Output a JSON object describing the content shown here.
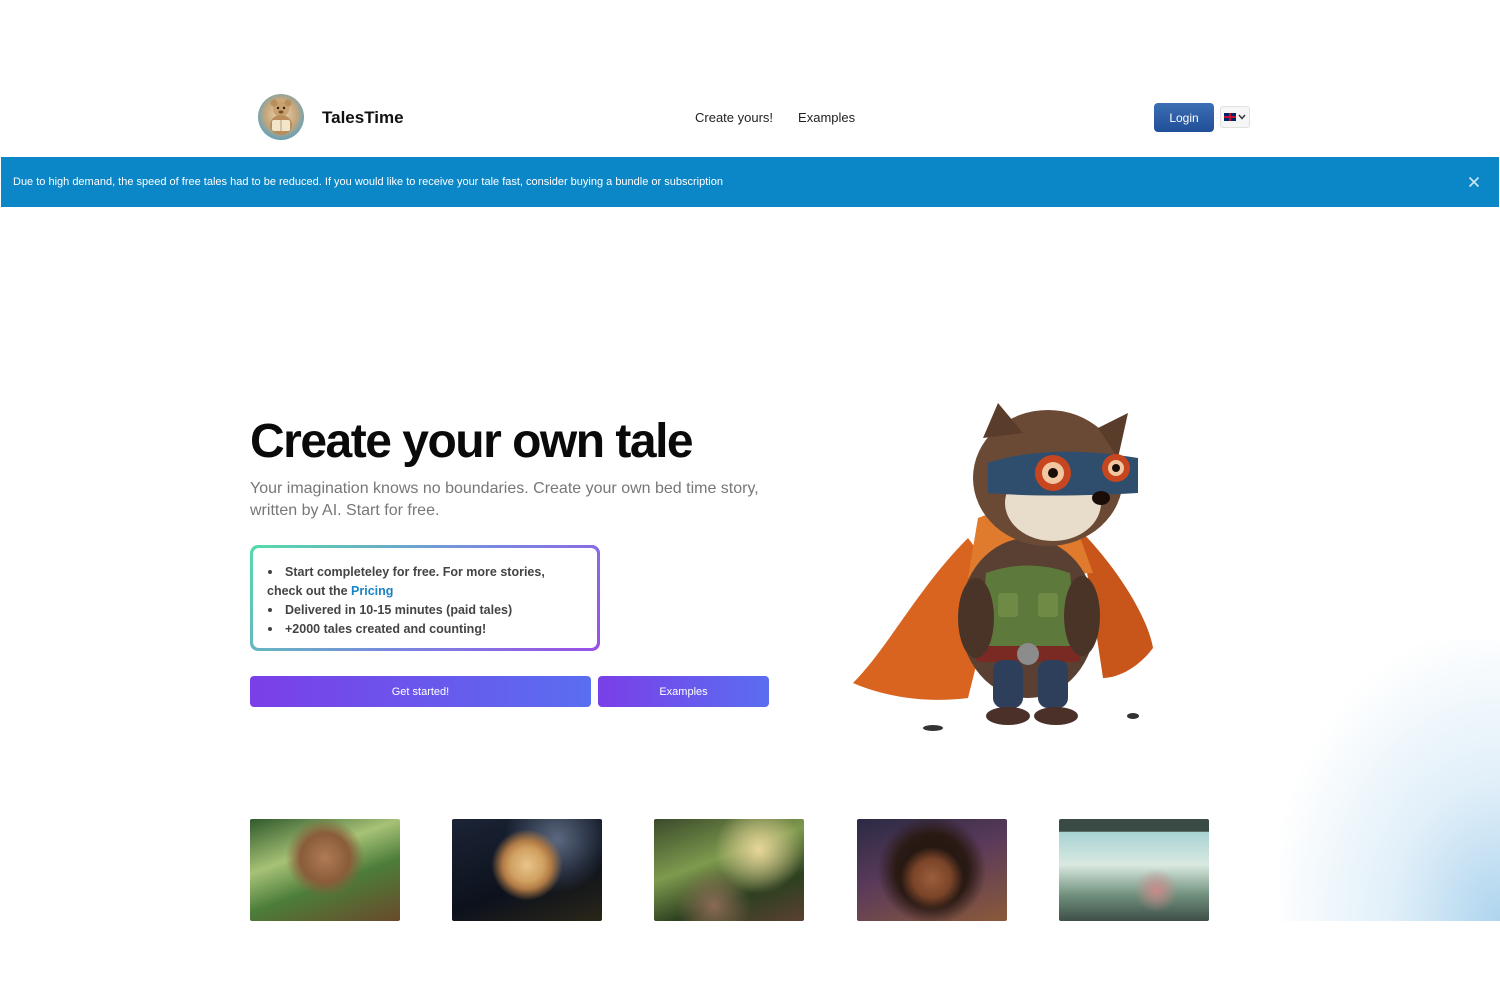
{
  "header": {
    "brand": "TalesTime",
    "nav": [
      "Create yours!",
      "Examples"
    ],
    "login_label": "Login",
    "language_icon": "uk-flag-icon"
  },
  "banner": {
    "text": "Due to high demand, the speed of free tales had to be reduced. If you would like to receive your tale fast, consider buying a bundle or subscription",
    "close_icon": "close-icon"
  },
  "hero": {
    "title": "Create your own tale",
    "subtitle": "Your imagination knows no boundaries. Create your own bed time story, written by AI. Start for free.",
    "features": {
      "item1_text": "Start completeley for free. For more stories, check out the ",
      "item1_link": "Pricing",
      "item2": "Delivered in 10-15 minutes (paid tales)",
      "item3": "+2000 tales created and counting!"
    },
    "cta_primary": "Get started!",
    "cta_secondary": "Examples"
  },
  "colors": {
    "banner": "#0b86c6",
    "login": "#2a5ba6",
    "cta_gradient_start": "#7a3fe8",
    "cta_gradient_end": "#5a6ef0",
    "link": "#1a83c5"
  }
}
